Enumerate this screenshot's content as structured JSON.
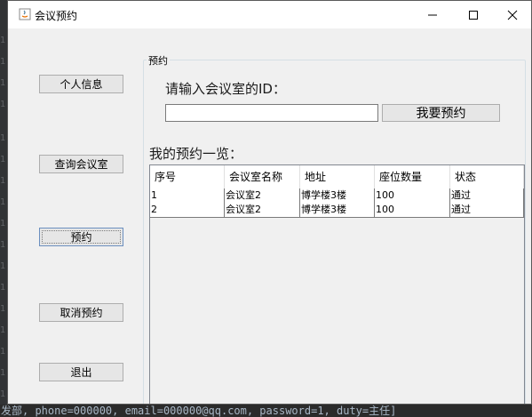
{
  "window": {
    "title": "会议预约"
  },
  "sidebar": {
    "personal_info": "个人信息",
    "query_rooms": "查询会议室",
    "reserve": "预约",
    "cancel_reservation": "取消预约",
    "exit": "退出"
  },
  "group": {
    "title": "预约"
  },
  "form": {
    "prompt": "请输入会议室的ID：",
    "room_id_value": "",
    "submit_label": "我要预约"
  },
  "reservations": {
    "title": "我的预约一览：",
    "columns": [
      "序号",
      "会议室名称",
      "地址",
      "座位数量",
      "状态"
    ],
    "rows": [
      [
        "1",
        "会议室2",
        "博学楼3楼",
        "100",
        "通过"
      ],
      [
        "2",
        "会议室2",
        "博学楼3楼",
        "100",
        "通过"
      ]
    ]
  },
  "background": {
    "bottom_text": "发部, phone=000000, email=000000@qq.com, password=1, duty=主任]"
  }
}
